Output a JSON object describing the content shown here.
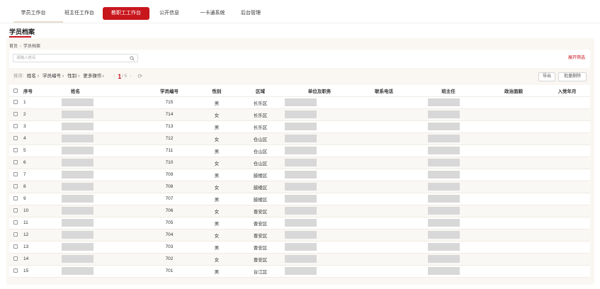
{
  "nav": {
    "tabs": [
      {
        "label": "学员工作台"
      },
      {
        "label": "班主任工作台"
      },
      {
        "label": "教职工工作台"
      },
      {
        "label": "公开信息"
      },
      {
        "label": "一卡通系统"
      },
      {
        "label": "后台管理"
      }
    ],
    "active_index": 2
  },
  "page": {
    "title": "学员档案",
    "breadcrumb": [
      "首页",
      "学员档案"
    ]
  },
  "filter": {
    "search_placeholder": "请输入姓名",
    "expand_label": "展开筛选"
  },
  "toolbar": {
    "sort_label": "排序:",
    "sort_items": [
      "姓名",
      "学员编号",
      "性别",
      "更多操作"
    ],
    "page_current": "1",
    "page_total": "/ 5",
    "export_label": "导出",
    "batch_delete_label": "批量删除"
  },
  "table": {
    "headers": {
      "no": "序号",
      "name": "姓名",
      "id": "学员编号",
      "gender": "性别",
      "area": "区域",
      "unit": "单位及职务",
      "phone": "联系电话",
      "teacher": "班主任",
      "political": "政治面貌",
      "join_date": "入党年月"
    },
    "rows": [
      {
        "no": "1",
        "id": "715",
        "gender": "男",
        "area": "长乐区"
      },
      {
        "no": "2",
        "id": "714",
        "gender": "女",
        "area": "长乐区"
      },
      {
        "no": "3",
        "id": "713",
        "gender": "男",
        "area": "长乐区"
      },
      {
        "no": "4",
        "id": "712",
        "gender": "女",
        "area": "仓山区"
      },
      {
        "no": "5",
        "id": "711",
        "gender": "男",
        "area": "仓山区"
      },
      {
        "no": "6",
        "id": "710",
        "gender": "女",
        "area": "仓山区"
      },
      {
        "no": "7",
        "id": "709",
        "gender": "男",
        "area": "鼓楼区"
      },
      {
        "no": "8",
        "id": "708",
        "gender": "女",
        "area": "鼓楼区"
      },
      {
        "no": "9",
        "id": "707",
        "gender": "男",
        "area": "鼓楼区"
      },
      {
        "no": "10",
        "id": "706",
        "gender": "女",
        "area": "晋安区"
      },
      {
        "no": "11",
        "id": "705",
        "gender": "男",
        "area": "晋安区"
      },
      {
        "no": "12",
        "id": "704",
        "gender": "女",
        "area": "晋安区"
      },
      {
        "no": "13",
        "id": "703",
        "gender": "男",
        "area": "晋安区"
      },
      {
        "no": "14",
        "id": "702",
        "gender": "女",
        "area": "晋安区"
      },
      {
        "no": "15",
        "id": "701",
        "gender": "男",
        "area": "台江区"
      }
    ]
  },
  "colors": {
    "accent": "#c8161d",
    "panel_bg": "#faf7f3",
    "redaction": "#d8d8d8"
  }
}
